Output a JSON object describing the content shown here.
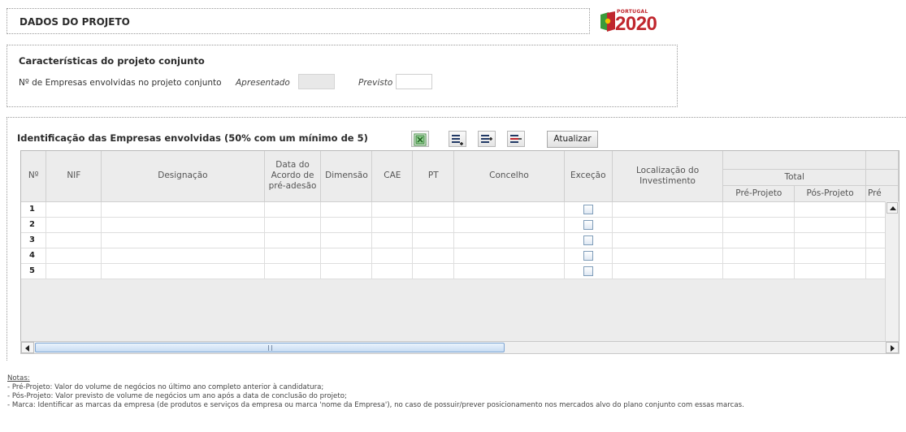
{
  "header": {
    "title": "DADOS DO PROJETO"
  },
  "logo": {
    "country": "PORTUGAL",
    "year": "2020"
  },
  "caracteristicas": {
    "title": "Características do projeto conjunto",
    "label": "Nº de Empresas envolvidas no projeto conjunto",
    "apresentado_label": "Apresentado",
    "apresentado_value": "",
    "previsto_label": "Previsto",
    "previsto_value": ""
  },
  "empresas": {
    "title": "Identificação das Empresas envolvidas (50% com um mínimo de 5)",
    "toolbar": {
      "icons": [
        "excel-export-icon",
        "add-row-icon",
        "insert-row-icon",
        "remove-row-icon"
      ],
      "update_label": "Atualizar"
    },
    "columns": {
      "n": "Nº",
      "nif": "NIF",
      "designacao": "Designação",
      "data_acordo": "Data do Acordo de pré-adesão",
      "dimensao": "Dimensão",
      "cae": "CAE",
      "pt": "PT",
      "concelho": "Concelho",
      "excecao": "Exceção",
      "localizacao": "Localização do Investimento",
      "total": "Total",
      "pre_projeto": "Pré-Projeto",
      "pos_projeto": "Pós-Projeto",
      "pre_cut": "Pré"
    },
    "rows": [
      {
        "n": "1"
      },
      {
        "n": "2"
      },
      {
        "n": "3"
      },
      {
        "n": "4"
      },
      {
        "n": "5"
      }
    ]
  },
  "notes": {
    "title": "Notas:",
    "lines": [
      "- Pré-Projeto: Valor do volume de negócios no último ano completo anterior à candidatura;",
      "- Pós-Projeto: Valor previsto de volume de negócios um ano após a data de conclusão do projeto;",
      "- Marca: Identificar as marcas da empresa (de produtos e serviços da empresa ou marca 'nome da Empresa'), no caso de possuir/prever posicionamento nos mercados alvo do plano conjunto com essas marcas."
    ]
  },
  "colors": {
    "brand_red": "#c0262d",
    "brand_green": "#3a9a3a",
    "grid_bg": "#ececec"
  }
}
